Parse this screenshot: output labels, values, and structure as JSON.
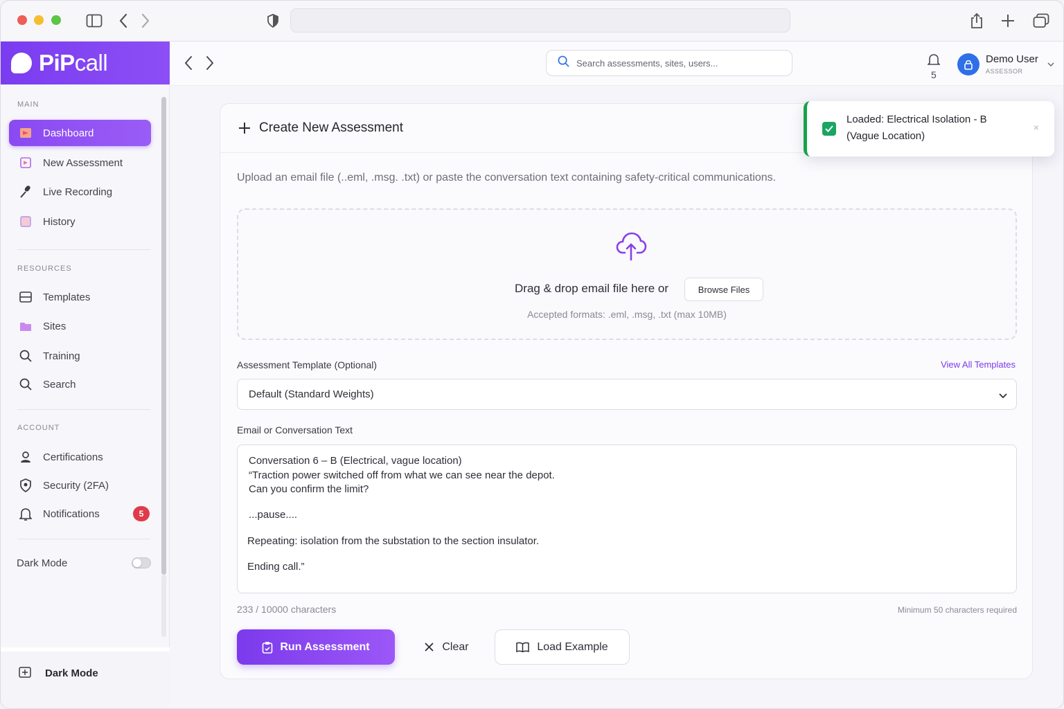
{
  "app": {
    "brand_bold": "PiP",
    "brand_rest": "call"
  },
  "header": {
    "search_placeholder": "Search assessments, sites, users...",
    "notification_count": "5",
    "user_name": "Demo User",
    "user_role": "ASSESSOR"
  },
  "sidebar": {
    "main_heading": "MAIN",
    "main_items": [
      {
        "label": "Dashboard",
        "icon": "dashboard-icon",
        "active": true
      },
      {
        "label": "New Assessment",
        "icon": "new-assessment-icon"
      },
      {
        "label": "Live Recording",
        "icon": "microphone-icon"
      },
      {
        "label": "History",
        "icon": "history-icon"
      }
    ],
    "resources_heading": "RESOURCES",
    "resource_items": [
      {
        "label": "Templates",
        "icon": "templates-icon"
      },
      {
        "label": "Sites",
        "icon": "folder-icon"
      },
      {
        "label": "Training",
        "icon": "search-icon"
      },
      {
        "label": "Search",
        "icon": "search-icon"
      }
    ],
    "account_heading": "ACCOUNT",
    "account_items": [
      {
        "label": "Certifications",
        "icon": "user-icon"
      },
      {
        "label": "Security (2FA)",
        "icon": "shield-icon"
      },
      {
        "label": "Notifications",
        "icon": "bell-icon",
        "badge": "5"
      }
    ],
    "dark_mode_label": "Dark Mode",
    "dark_mode_on": false,
    "footer_label": "Dark Mode"
  },
  "card": {
    "title": "Create New Assessment",
    "description": "Upload an email file (..eml, .msg. .txt) or paste the conversation text containing safety-critical communications.",
    "dropzone_text": "Drag & drop email file here or",
    "browse_label": "Browse Files",
    "accepted_formats": "Accepted formats: .eml, .msg, .txt (max 10MB)",
    "template_label": "Assessment Template (Optional)",
    "view_all_templates": "View All Templates",
    "template_selected": "Default (Standard Weights)",
    "text_label": "Email or Conversation Text",
    "conversation_lines": [
      "Conversation 6 – B (Electrical, vague location)",
      "“Traction power switched off from what we can see near the depot.",
      "Can you confirm the limit?",
      "...pause....",
      "Repeating: isolation from the substation to the section insulator.",
      "Ending call.”"
    ],
    "char_count": "233 / 10000 characters",
    "min_required": "Minimum 50 characters required",
    "run_label": "Run Assessment",
    "clear_label": "Clear",
    "load_example_label": "Load Example"
  },
  "toast": {
    "message": "Loaded: Electrical Isolation - B (Vague Location)",
    "close_symbol": "×"
  },
  "colors": {
    "accent": "#7c3aed",
    "success": "#16a34a",
    "danger": "#e03b4a"
  }
}
